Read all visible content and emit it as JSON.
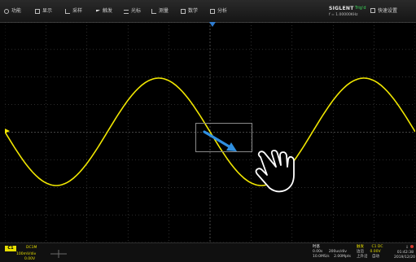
{
  "menubar": {
    "items": [
      {
        "label": "功能",
        "icon": "function-icon"
      },
      {
        "label": "显示",
        "icon": "display-icon"
      },
      {
        "label": "采样",
        "icon": "acquire-icon"
      },
      {
        "label": "触发",
        "icon": "trigger-flag-icon"
      },
      {
        "label": "光标",
        "icon": "cursor-icon"
      },
      {
        "label": "测量",
        "icon": "measure-icon"
      },
      {
        "label": "数学",
        "icon": "math-icon"
      },
      {
        "label": "分析",
        "icon": "analysis-icon"
      }
    ],
    "brand": "SIGLENT",
    "run_mode": "Trig'd",
    "trigger_frequency": "f = 1.00000KHz",
    "quick_settings": "快速设置"
  },
  "channel1": {
    "badge": "C1",
    "coupling": "DC1M",
    "scale": "100mV/div",
    "offset": "0.00V",
    "color": "#e8df00"
  },
  "timebase": {
    "title": "时基",
    "delay": "0.00s",
    "scale": "200us/div",
    "sample_rate": "10.0MS/s",
    "memory": "2.00Mpts"
  },
  "trigger": {
    "title": "触发",
    "source": "C1 DC",
    "mode": "边沿",
    "mode_value": "0.00V",
    "type": "上升沿",
    "type_value": "自动"
  },
  "clock": {
    "time": "01:42:38",
    "date": "2019/12/20"
  },
  "waveform": {
    "color": "#f0e600",
    "grid_color": "#5a5a5a",
    "cycles_shown": 2,
    "center_phase_deg": 180
  },
  "gesture": {
    "arrow_color": "#2f8fe0",
    "hint": "drag-to-zoom"
  }
}
